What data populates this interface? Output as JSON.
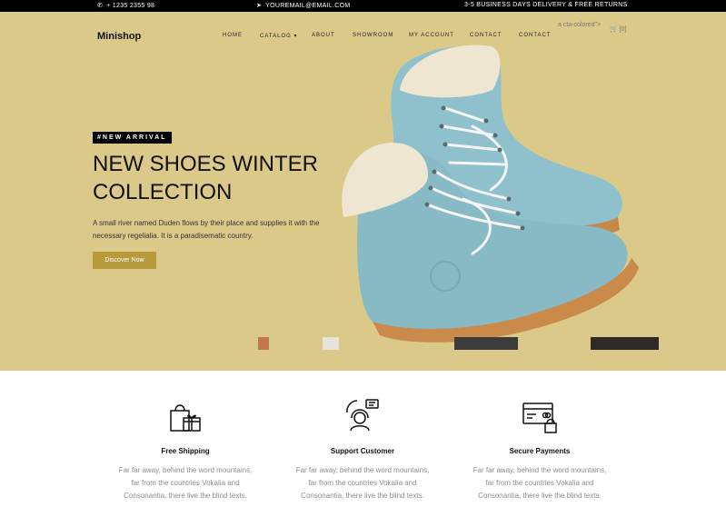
{
  "topbar": {
    "phone": "+ 1235 2355 98",
    "email": "YOUREMAIL@EMAIL.COM",
    "delivery": "3-5 BUSINESS DAYS DELIVERY & FREE RETURNS"
  },
  "brand": {
    "name": "Minishop"
  },
  "nav": {
    "home": "HOME",
    "catalog": "CATALOG",
    "about": "ABOUT",
    "showroom": "SHOWROOM",
    "account": "MY ACCOUNT",
    "contact1": "CONTACT",
    "contact2": "CONTACT",
    "cta_artifact": "a cta-colored\">",
    "cart": "[0]"
  },
  "hero": {
    "badge": "#NEW ARRIVAL",
    "title_line1": "NEW SHOES WINTER",
    "title_line2": "COLLECTION",
    "desc": "A small river named Duden flows by their place and supplies it with the necessary regelialia. It is a paradisematic country.",
    "button": "Discover Now"
  },
  "features": [
    {
      "title": "Free Shipping",
      "text": "Far far away, behind the word mountains, far from the countries Vokalia and Consonantia, there live the blind texts."
    },
    {
      "title": "Support Customer",
      "text": "Far far away, behind the word mountains, far from the countries Vokalia and Consonantia, there live the blind texts."
    },
    {
      "title": "Secure Payments",
      "text": "Far far away, behind the word mountains, far from the countries Vokalia and Consonantia, there live the blind texts."
    }
  ],
  "colors": {
    "topbar_bg": "#000000",
    "hero_bg": "#dbc98a",
    "button_bg": "#b79a3a",
    "boot_color": "#8bbdc8",
    "sole_color": "#c98a4a"
  },
  "icons": {
    "phone": "phone-icon",
    "email": "paper-plane-icon",
    "cart": "cart-icon",
    "free_shipping": "gift-bag-icon",
    "support": "headset-icon",
    "payments": "credit-card-lock-icon"
  }
}
